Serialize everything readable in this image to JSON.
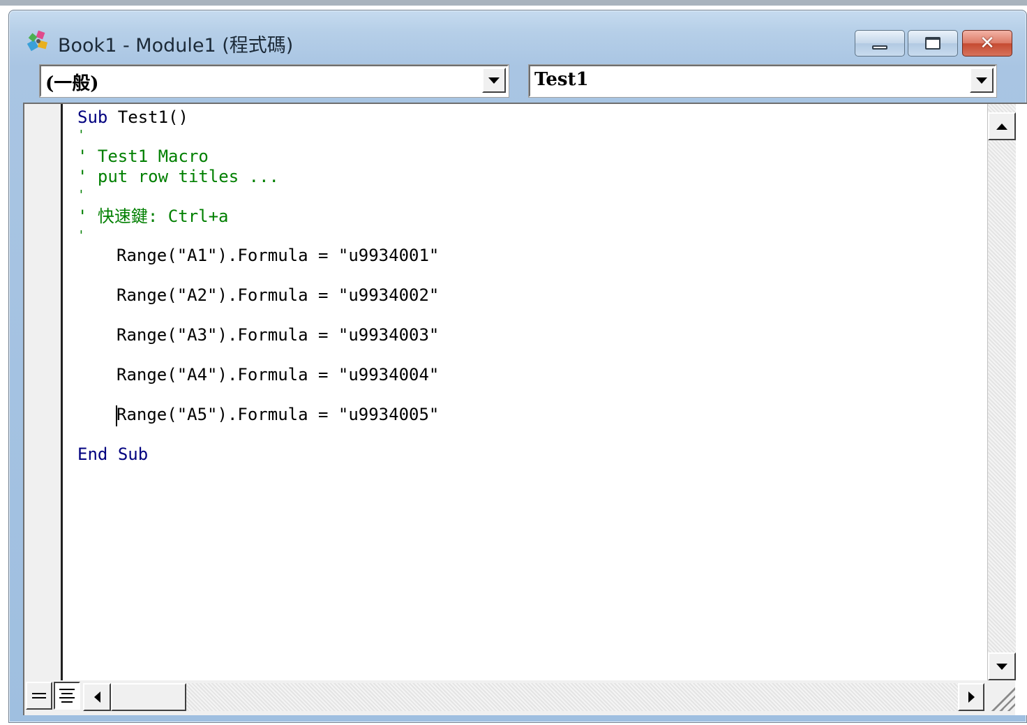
{
  "window": {
    "title": "Book1 - Module1 (程式碼)"
  },
  "object_combo": {
    "value": "(一般)"
  },
  "procedure_combo": {
    "value": "Test1"
  },
  "code": {
    "line1_kw": "Sub",
    "line1_rest": " Test1()",
    "comment_mark": "'",
    "comment_title": "' Test1 Macro",
    "comment_desc": "' put row titles ...",
    "comment_shortcut": "' 快速鍵: Ctrl+a",
    "stmt1": "Range(\"A1\").Formula = \"u9934001\"",
    "stmt2": "Range(\"A2\").Formula = \"u9934002\"",
    "stmt3": "Range(\"A3\").Formula = \"u9934003\"",
    "stmt4": "Range(\"A4\").Formula = \"u9934004\"",
    "stmt5": "Range(\"A5\").Formula = \"u9934005\"",
    "end_kw1": "End",
    "end_kw2": "Sub"
  },
  "colors": {
    "keyword": "#00007f",
    "comment": "#007f00",
    "text": "#000000"
  },
  "icons": {
    "app": "vba-project-icon",
    "minimize": "minimize-icon",
    "maximize": "maximize-icon",
    "close": "close-icon"
  }
}
